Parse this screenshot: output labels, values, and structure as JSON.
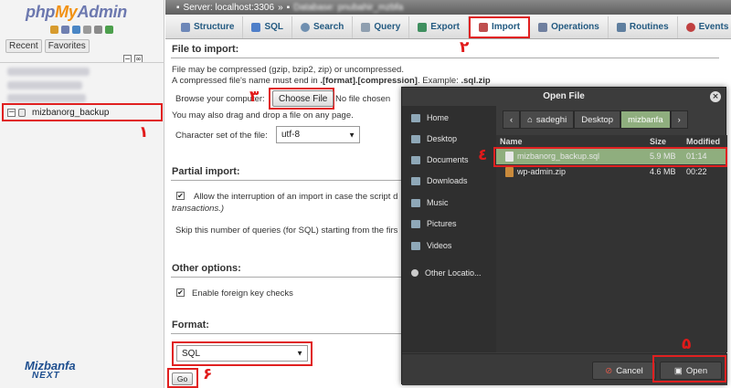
{
  "sidebar": {
    "logo": {
      "php": "php",
      "my": "My",
      "admin": "Admin"
    },
    "tabs": [
      "Recent",
      "Favorites"
    ],
    "selected_db": "mizbanorg_backup"
  },
  "serverbar": {
    "server": "Server: localhost:3306",
    "sep": "»",
    "database": "Database: pnubahir_mzbfa"
  },
  "tabs": [
    {
      "label": "Structure",
      "icon": "structure-icon",
      "color": "#6d87b8"
    },
    {
      "label": "SQL",
      "icon": "sql-icon",
      "color": "#4f7fc9"
    },
    {
      "label": "Search",
      "icon": "search-icon",
      "color": "#6f8fb0"
    },
    {
      "label": "Query",
      "icon": "query-icon",
      "color": "#8f9fb0"
    },
    {
      "label": "Export",
      "icon": "export-icon",
      "color": "#3f8f5f"
    },
    {
      "label": "Import",
      "icon": "import-icon",
      "color": "#bf4f4f"
    },
    {
      "label": "Operations",
      "icon": "wrench-icon",
      "color": "#6f7f9f"
    },
    {
      "label": "Routines",
      "icon": "routines-icon",
      "color": "#5f7f9f"
    },
    {
      "label": "Events",
      "icon": "clock-icon",
      "color": "#c04040"
    }
  ],
  "form": {
    "file_to_import": "File to import:",
    "compress_line1": "File may be compressed (gzip, bzip2, zip) or uncompressed.",
    "compress_line2_a": "A compressed file's name must end in ",
    "compress_line2_b": ".[format].[compression]",
    "compress_line2_c": ". Example: ",
    "compress_line2_d": ".sql.zip",
    "browse_label": "Browse your computer:",
    "choose_file": "Choose File",
    "no_file": "No file chosen",
    "drag_drop": "You may also drag and drop a file on any page.",
    "charset_label": "Character set of the file:",
    "charset_value": "utf-8",
    "partial_import": "Partial import:",
    "interrupt_text": "Allow the interruption of an import in case the script d",
    "interrupt_text2": "transactions.)",
    "skip_text": "Skip this number of queries (for SQL) starting from the firs",
    "other_options": "Other options:",
    "foreign_keys": "Enable foreign key checks",
    "format": "Format:",
    "format_value": "SQL",
    "go": "Go"
  },
  "steps": {
    "s1": "١",
    "s2": "٢",
    "s3": "٣",
    "s4": "٤",
    "s5": "۵",
    "s6": "۶"
  },
  "dialog": {
    "title": "Open File",
    "places": [
      "Home",
      "Desktop",
      "Documents",
      "Downloads",
      "Music",
      "Pictures",
      "Videos",
      "Other Locatio..."
    ],
    "path": [
      "sadeghi",
      "Desktop",
      "mizbanfa"
    ],
    "columns": {
      "name": "Name",
      "size": "Size",
      "modified": "Modified"
    },
    "files": [
      {
        "name": "mizbanorg_backup.sql",
        "size": "5.9 MB",
        "modified": "01:14"
      },
      {
        "name": "wp-admin.zip",
        "size": "4.6 MB",
        "modified": "00:22"
      }
    ],
    "cancel": "Cancel",
    "open": "Open"
  },
  "brand": {
    "line1": "Mizbanfa",
    "line2": "NEXT"
  }
}
